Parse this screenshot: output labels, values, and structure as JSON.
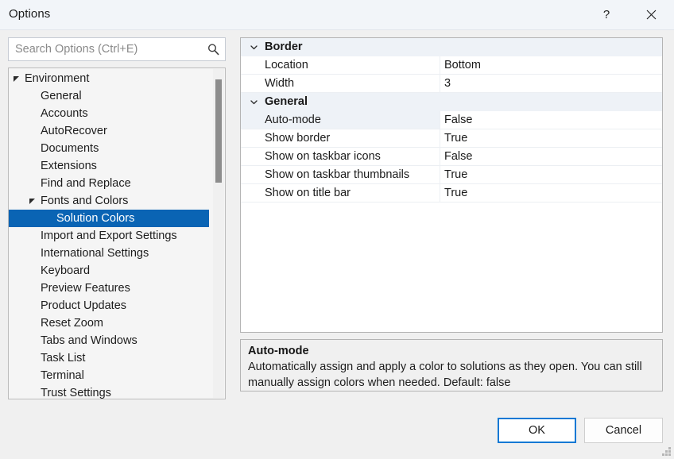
{
  "window": {
    "title": "Options",
    "help_label": "?",
    "close_label": "✕"
  },
  "search": {
    "placeholder": "Search Options (Ctrl+E)",
    "value": "",
    "icon": "search-icon"
  },
  "tree": {
    "items": [
      {
        "label": "Environment",
        "level": 0,
        "expander": "expanded",
        "selected": false
      },
      {
        "label": "General",
        "level": 1,
        "expander": "none",
        "selected": false
      },
      {
        "label": "Accounts",
        "level": 1,
        "expander": "none",
        "selected": false
      },
      {
        "label": "AutoRecover",
        "level": 1,
        "expander": "none",
        "selected": false
      },
      {
        "label": "Documents",
        "level": 1,
        "expander": "none",
        "selected": false
      },
      {
        "label": "Extensions",
        "level": 1,
        "expander": "none",
        "selected": false
      },
      {
        "label": "Find and Replace",
        "level": 1,
        "expander": "none",
        "selected": false
      },
      {
        "label": "Fonts and Colors",
        "level": 1,
        "expander": "expanded",
        "selected": false
      },
      {
        "label": "Solution Colors",
        "level": 2,
        "expander": "none",
        "selected": true
      },
      {
        "label": "Import and Export Settings",
        "level": 1,
        "expander": "none",
        "selected": false
      },
      {
        "label": "International Settings",
        "level": 1,
        "expander": "none",
        "selected": false
      },
      {
        "label": "Keyboard",
        "level": 1,
        "expander": "none",
        "selected": false
      },
      {
        "label": "Preview Features",
        "level": 1,
        "expander": "none",
        "selected": false
      },
      {
        "label": "Product Updates",
        "level": 1,
        "expander": "none",
        "selected": false
      },
      {
        "label": "Reset Zoom",
        "level": 1,
        "expander": "none",
        "selected": false
      },
      {
        "label": "Tabs and Windows",
        "level": 1,
        "expander": "none",
        "selected": false
      },
      {
        "label": "Task List",
        "level": 1,
        "expander": "none",
        "selected": false
      },
      {
        "label": "Terminal",
        "level": 1,
        "expander": "none",
        "selected": false
      },
      {
        "label": "Trust Settings",
        "level": 1,
        "expander": "none",
        "selected": false
      }
    ]
  },
  "grid": {
    "rows": [
      {
        "kind": "category",
        "name": "Border",
        "value": "",
        "expanded": true,
        "selected": false
      },
      {
        "kind": "property",
        "name": "Location",
        "value": "Bottom",
        "expanded": false,
        "selected": false
      },
      {
        "kind": "property",
        "name": "Width",
        "value": "3",
        "expanded": false,
        "selected": false
      },
      {
        "kind": "category",
        "name": "General",
        "value": "",
        "expanded": true,
        "selected": false
      },
      {
        "kind": "property",
        "name": "Auto-mode",
        "value": "False",
        "expanded": false,
        "selected": true
      },
      {
        "kind": "property",
        "name": "Show border",
        "value": "True",
        "expanded": false,
        "selected": false
      },
      {
        "kind": "property",
        "name": "Show on taskbar icons",
        "value": "False",
        "expanded": false,
        "selected": false
      },
      {
        "kind": "property",
        "name": "Show on taskbar thumbnails",
        "value": "True",
        "expanded": false,
        "selected": false
      },
      {
        "kind": "property",
        "name": "Show on title bar",
        "value": "True",
        "expanded": false,
        "selected": false
      }
    ]
  },
  "description": {
    "title": "Auto-mode",
    "body": "Automatically assign and apply a color to solutions as they open. You can still manually assign colors when needed. Default: false"
  },
  "footer": {
    "ok_label": "OK",
    "cancel_label": "Cancel"
  },
  "colors": {
    "accent": "#0a64b4",
    "focus_border": "#0a78d4",
    "titlebar_bg": "#f2f5f9",
    "dialog_bg": "#f0f0f0",
    "category_row_bg": "#eef2f7",
    "scrollbar_thumb": "#8d8d8d"
  }
}
